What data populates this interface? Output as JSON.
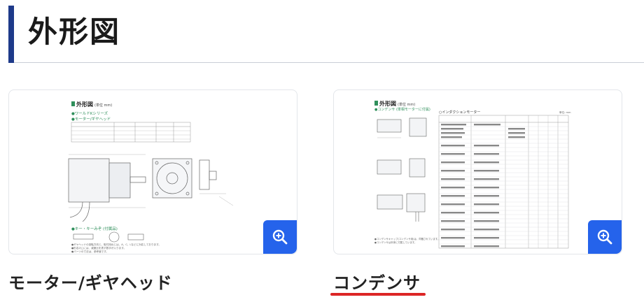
{
  "page": {
    "title": "外形図"
  },
  "cards": [
    {
      "caption": "モーター/ギヤヘッド",
      "zoom_icon": "zoom-in-icon",
      "image": {
        "header": "外形図",
        "header_unit": "(単位 mm)",
        "lines": [
          "●ワールドKシリーズ",
          "●モーター/ギヤヘッド"
        ],
        "key_heading": "●キー・キーみぞ (付属品)",
        "footnote_lines": [
          "●ギヤヘッドの回転方向と、取付用ねじは、A、C、Lなどに対応しております。",
          "●形名の□には、減速比を表す数字が入ります。",
          "●パーツの寸法は、参考値です。"
        ]
      }
    },
    {
      "caption": "コンデンサ",
      "zoom_icon": "zoom-in-icon",
      "image": {
        "header": "外形図",
        "header_unit": "(単位 mm)",
        "subtitle": "●コンデンサ (単相モーターに付属)",
        "table_title": "○インダクションモーター",
        "table_unit": "単位: mm",
        "footnote_lines": [
          "●コンデンサキャップ(コンデンサ用)は、同梱されています。",
          "●コンデンサは本体に付属しています。"
        ]
      }
    }
  ],
  "colors": {
    "heading_bar": "#1e3a8a",
    "zoom_button": "#2563eb",
    "active_underline": "#dc2626",
    "diagram_accent": "#2f8f5b"
  }
}
